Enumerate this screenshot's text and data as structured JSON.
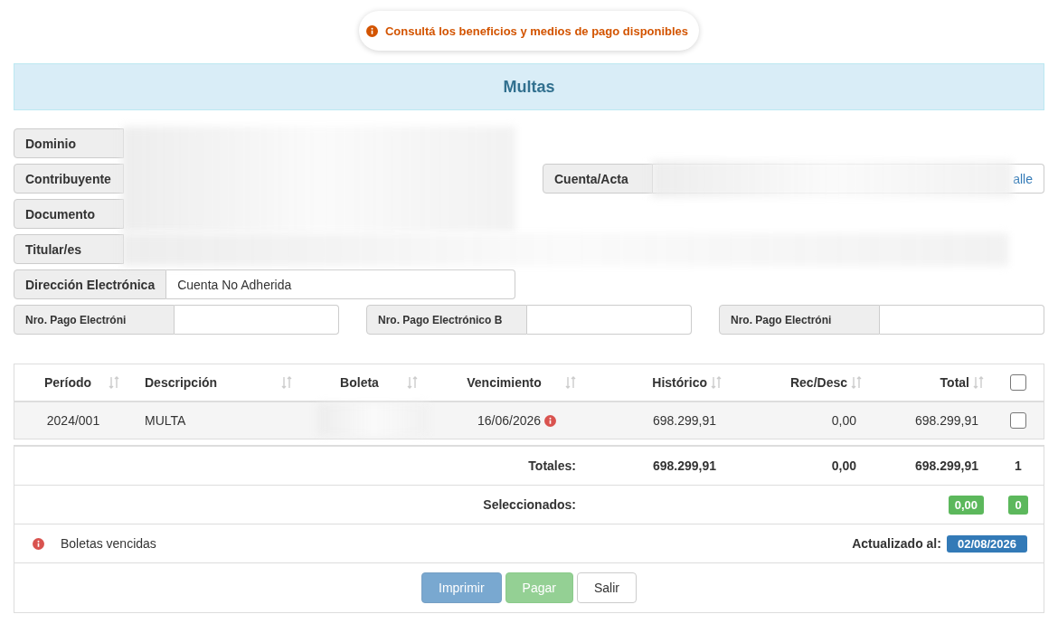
{
  "notice": {
    "text": "Consultá los beneficios y medios de pago disponibles"
  },
  "panel": {
    "title": "Multas"
  },
  "field_rows": [
    [
      {
        "label": "Dominio",
        "kind": "short"
      }
    ],
    [
      {
        "label": "Contribuyente",
        "kind": "short"
      },
      {
        "label": "Cuenta/Acta",
        "kind": "short",
        "button": "alle"
      }
    ],
    [
      {
        "label": "Documento",
        "kind": "short"
      }
    ],
    [
      {
        "label": "Titular/es",
        "kind": "wide"
      }
    ],
    [
      {
        "label": "Dirección Electrónica",
        "kind": "short",
        "value": "Cuenta No Adherida"
      }
    ]
  ],
  "payment_codes": [
    {
      "label": "Nro. Pago Electróni"
    },
    {
      "label": "Nro. Pago Electrónico B"
    },
    {
      "label": "Nro. Pago Electróni"
    }
  ],
  "table": {
    "columns": [
      "Período",
      "Descripción",
      "Boleta",
      "Vencimiento",
      "Histórico",
      "Rec/Desc",
      "Total"
    ],
    "select_all": {
      "checked": false
    },
    "rows": [
      {
        "cells": [
          "2024/001",
          "MULTA",
          "",
          "16/06/2026",
          "698.299,91",
          "0,00",
          "698.299,91"
        ],
        "overdue": true,
        "checked": false
      }
    ]
  },
  "totals": {
    "label": "Totales:",
    "historico": "698.299,91",
    "rec_desc": "0,00",
    "total": "698.299,91",
    "count": "1"
  },
  "selected": {
    "label": "Seleccionados:",
    "amount": "0,00",
    "count": "0"
  },
  "legend": {
    "text": "Boletas vencidas",
    "updated_label": "Actualizado al:",
    "updated_date": "02/08/2026"
  },
  "buttons": [
    {
      "label": "Imprimir",
      "kind": "primary",
      "disabled": true
    },
    {
      "label": "Pagar",
      "kind": "success",
      "disabled": true
    },
    {
      "label": "Salir",
      "kind": "default",
      "disabled": false
    }
  ]
}
